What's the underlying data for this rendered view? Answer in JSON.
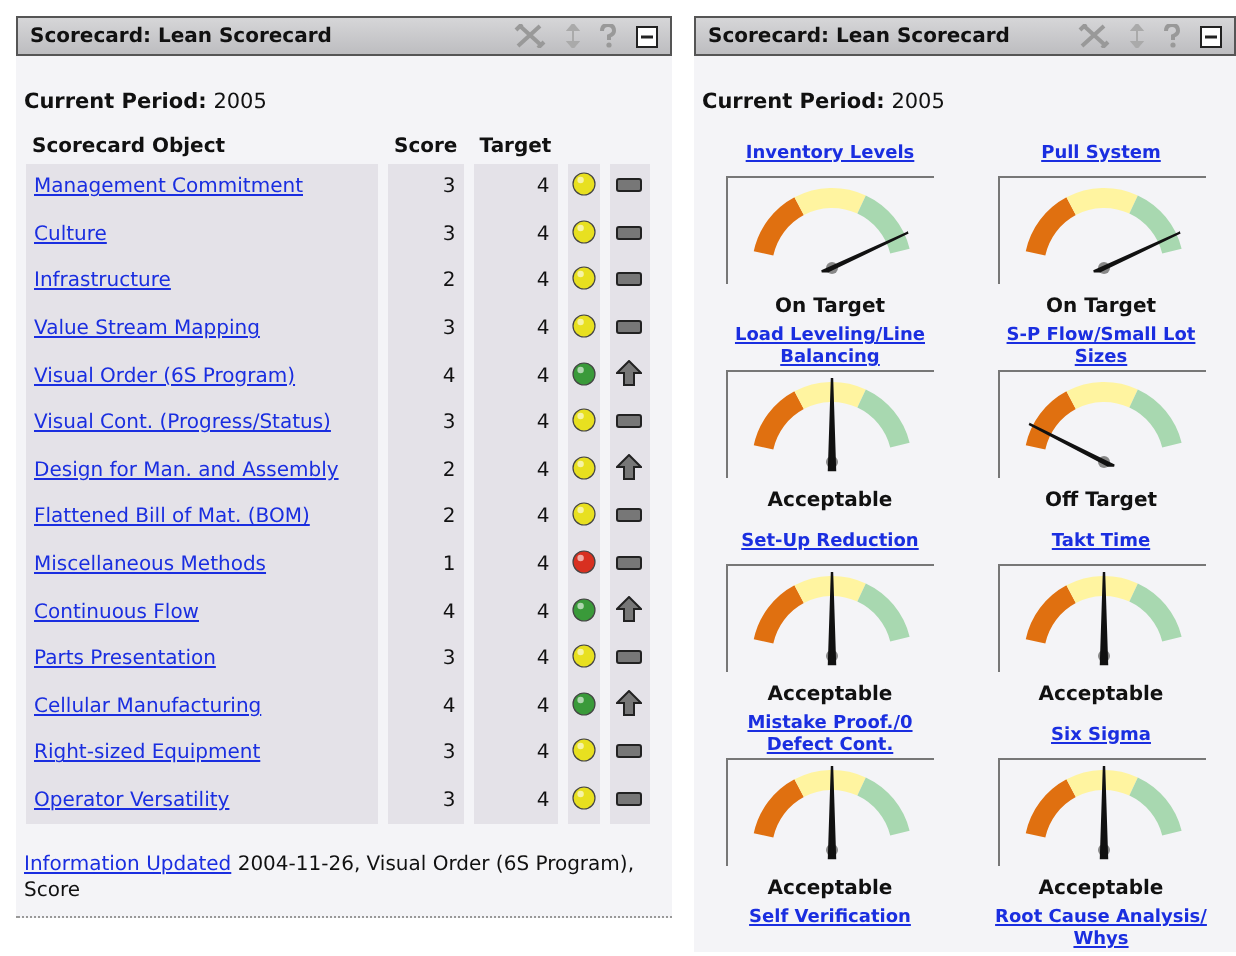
{
  "panels": [
    {
      "kind": "table",
      "title": "Scorecard: Lean Scorecard",
      "period_label": "Current Period:",
      "period": "2005",
      "columns": [
        "Scorecard Object",
        "Score",
        "Target"
      ],
      "rows": [
        {
          "name": "Management Commitment",
          "score": "3",
          "target": "4",
          "color": "#e8e020",
          "kind": "flat"
        },
        {
          "name": "Culture",
          "score": "3",
          "target": "4",
          "color": "#e8e020",
          "kind": "flat"
        },
        {
          "name": "Infrastructure",
          "score": "2",
          "target": "4",
          "color": "#e8e020",
          "kind": "flat"
        },
        {
          "name": "Value Stream Mapping",
          "score": "3",
          "target": "4",
          "color": "#e8e020",
          "kind": "flat"
        },
        {
          "name": "Visual Order (6S Program)",
          "score": "4",
          "target": "4",
          "color": "#3a9a3a",
          "kind": "up"
        },
        {
          "name": "Visual Cont. (Progress/Status)",
          "score": "3",
          "target": "4",
          "color": "#e8e020",
          "kind": "flat"
        },
        {
          "name": "Design for Man. and Assembly",
          "score": "2",
          "target": "4",
          "color": "#e8e020",
          "kind": "up"
        },
        {
          "name": "Flattened Bill of Mat. (BOM)",
          "score": "2",
          "target": "4",
          "color": "#e8e020",
          "kind": "flat"
        },
        {
          "name": "Miscellaneous Methods",
          "score": "1",
          "target": "4",
          "color": "#d83020",
          "kind": "flat"
        },
        {
          "name": "Continuous Flow",
          "score": "4",
          "target": "4",
          "color": "#3a9a3a",
          "kind": "up"
        },
        {
          "name": "Parts Presentation",
          "score": "3",
          "target": "4",
          "color": "#e8e020",
          "kind": "flat"
        },
        {
          "name": "Cellular Manufacturing",
          "score": "4",
          "target": "4",
          "color": "#3a9a3a",
          "kind": "up"
        },
        {
          "name": "Right-sized Equipment",
          "score": "3",
          "target": "4",
          "color": "#e8e020",
          "kind": "flat"
        },
        {
          "name": "Operator Versatility",
          "score": "3",
          "target": "4",
          "color": "#e8e020",
          "kind": "flat"
        }
      ],
      "footer_link": "Information Updated",
      "footer_text": "2004-11-26, Visual Order (6S Program), Score"
    },
    {
      "kind": "gauges",
      "title": "Scorecard: Lean Scorecard",
      "period_label": "Current Period:",
      "period": "2005",
      "gauges": [
        {
          "title": "Inventory Levels",
          "kind": "on_target",
          "status": "On Target"
        },
        {
          "title": "Pull System",
          "kind": "on_target",
          "status": "On Target"
        },
        {
          "title": "Load Leveling/Line Balancing",
          "kind": "acceptable",
          "status": "Acceptable"
        },
        {
          "title": "S-P Flow/Small Lot Sizes",
          "kind": "off_target",
          "status": "Off Target"
        },
        {
          "title": "Set-Up Reduction",
          "kind": "acceptable",
          "status": "Acceptable"
        },
        {
          "title": "Takt Time",
          "kind": "acceptable",
          "status": "Acceptable"
        },
        {
          "title": "Mistake Proof./0 Defect Cont.",
          "kind": "acceptable",
          "status": "Acceptable"
        },
        {
          "title": "Six Sigma",
          "kind": "acceptable",
          "status": "Acceptable"
        },
        {
          "title": "Self Verification"
        },
        {
          "title": "Root Cause Analysis/ Whys"
        }
      ]
    }
  ]
}
